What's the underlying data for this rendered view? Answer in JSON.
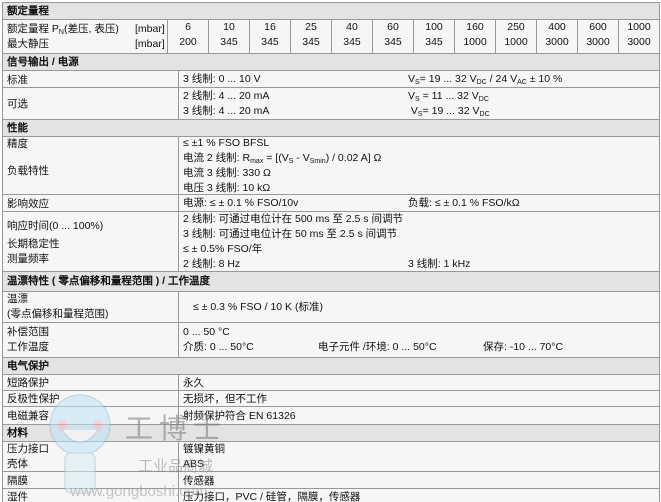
{
  "range": {
    "title": "额定量程",
    "row1_label": "额定量程 P",
    "row1_sub": "N",
    "row1_label_tail": "(差压, 表压)",
    "row2_label": "最大静压",
    "unit": "[mbar]",
    "nominal": [
      "6",
      "10",
      "16",
      "25",
      "40",
      "60",
      "100",
      "160",
      "250",
      "400",
      "600",
      "1000"
    ],
    "max_static": [
      "200",
      "345",
      "345",
      "345",
      "345",
      "345",
      "345",
      "1000",
      "1000",
      "3000",
      "3000",
      "3000"
    ]
  },
  "signal": {
    "title": "信号输出 / 电源",
    "standard_label": "标准",
    "standard_value": "3 线制: 0 ... 10 V",
    "standard_supply": "V",
    "standard_supply_sub": "S",
    "standard_supply_text": "= 19 ... 32 V",
    "standard_supply_dc": "DC",
    "standard_supply_tail": " / 24 V",
    "standard_supply_ac": "AC",
    "standard_supply_end": " ± 10 %",
    "optional_label": "可选",
    "opt1": "2 线制: 4 ... 20 mA",
    "opt1_supply": "= 11 ... 32 V",
    "opt2": "3 线制: 4 ... 20 mA",
    "opt2_supply": "= 19 ... 32 V"
  },
  "performance": {
    "title": "性能",
    "accuracy_label": "精度",
    "accuracy": "≤ ±1 % FSO BFSL",
    "load_label": "负载特性",
    "load1_a": "电流 2 线制: R",
    "load1_max": "max",
    "load1_b": " = [(V",
    "load1_s": "S",
    "load1_c": " - V",
    "load1_smin": "Smin",
    "load1_d": ") / 0.02 A] Ω",
    "load2": "电流 3 线制: 330 Ω",
    "load3": "电压 3 线制: 10 kΩ",
    "influence_label": "影响效应",
    "influence_supply": "电源: ≤ ± 0.1 % FSO/10v",
    "influence_load": "负载: ≤ ± 0.1 % FSO/kΩ",
    "response_label": "响应时间(0 ... 100%)",
    "response1": "2 线制: 可通过电位计在 500 ms 至 2.5 s 间调节",
    "response2": "3 线制: 可通过电位计在 50 ms 至 2.5 s 间调节",
    "stability_label": "长期稳定性",
    "stability": "≤ ± 0.5% FSO/年",
    "freq_label": "测量频率",
    "freq1": "2 线制: 8 Hz",
    "freq2": "3 线制: 1 kHz"
  },
  "thermal": {
    "title": "温漂特性 ( 零点偏移和量程范围 ) / 工作温度",
    "drift_label": "温漂",
    "drift_label2": "(零点偏移和量程范围)",
    "drift": "≤ ± 0.3 % FSO / 10 K (标准)",
    "comp_label": "补偿范围",
    "comp": "0 ... 50 °C",
    "op_label": "工作温度",
    "op_medium": "介质: 0 ... 50°C",
    "op_env": "电子元件 /环境: 0 ... 50°C",
    "op_storage": "保存: -10 ... 70°C"
  },
  "electrical": {
    "title": "电气保护",
    "short_label": "短路保护",
    "short": "永久",
    "reverse_label": "反极性保护",
    "reverse": "无损坏，但不工作",
    "emc_label": "电磁兼容",
    "emc": "射频保护符合  EN 61326"
  },
  "materials": {
    "title": "材料",
    "port_label": "压力接口",
    "port": "镀镍黄铜",
    "housing_label": "壳体",
    "housing": "ABS",
    "diaphragm_label": "隔膜",
    "diaphragm": "传感器",
    "wetted_label": "湿件",
    "wetted": "压力接口，PVC / 硅管，隔膜，传感器"
  },
  "watermark": {
    "brand": "工博士",
    "sub": "工业品商城",
    "url": "www.gongboshi.com"
  }
}
